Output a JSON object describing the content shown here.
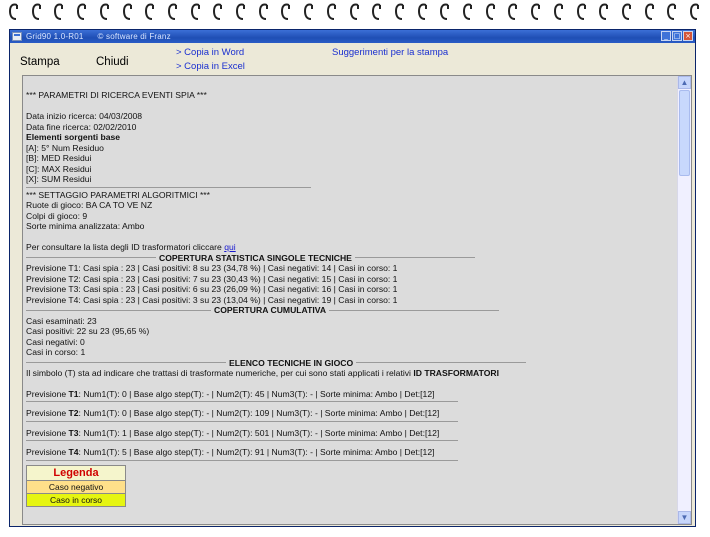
{
  "window": {
    "app_title": "Grid90 1.0-R01",
    "copyright": "© software di Franz",
    "buttons": {
      "minimize": "_",
      "maximize": "□",
      "close": "×"
    }
  },
  "toolbar": {
    "stampa": "Stampa",
    "chiudi": "Chiudi",
    "copia_word": "> Copia in Word",
    "copia_excel": "> Copia in Excel",
    "suggerimenti": "Suggerimenti per la stampa"
  },
  "report": {
    "header": "*** PARAMETRI DI RICERCA EVENTI SPIA ***",
    "data_inizio": "Data inizio ricerca: 04/03/2008",
    "data_fine": "Data fine ricerca: 02/02/2010",
    "elementi_title": "Elementi sorgenti base",
    "elementi": [
      "[A]: 5° Num Residuo",
      "[B]: MED Residui",
      "[C]: MAX Residui",
      "[X]: SUM Residui"
    ],
    "settaggio_title": "*** SETTAGGIO PARAMETRI ALGORITMICI ***",
    "ruote": "Ruote di gioco: BA CA TO VE NZ",
    "colpi": "Colpi di gioco: 9",
    "sorte": "Sorte minima analizzata: Ambo",
    "consult_text": "Per consultare la lista degli ID trasformatori cliccare ",
    "consult_link": "qui",
    "copertura_title": "COPERTURA STATISTICA SINGOLE TECNICHE",
    "previsioni_stat": [
      "Previsione T1: Casi spia : 23 | Casi positivi: 8 su 23 (34,78 %) | Casi negativi: 14 | Casi in corso: 1",
      "Previsione T2: Casi spia : 23 | Casi positivi: 7 su 23 (30,43 %) | Casi negativi: 15 | Casi in corso: 1",
      "Previsione T3: Casi spia : 23 | Casi positivi: 6 su 23 (26,09 %) | Casi negativi: 16 | Casi in corso: 1",
      "Previsione T4: Casi spia : 23 | Casi positivi: 3 su 23 (13,04 %) | Casi negativi: 19 | Casi in corso: 1"
    ],
    "cumulativa_title": "COPERTURA CUMULATIVA",
    "casi_esaminati": "Casi esaminati: 23",
    "casi_positivi": "Casi positivi: 22 su 23 (95,65 %)",
    "casi_negativi": "Casi negativi: 0",
    "casi_in_corso": "Casi in corso: 1",
    "elenco_title": "ELENCO TECNICHE IN GIOCO",
    "simbolo_text": "Il simbolo (T) sta ad indicare che trattasi di trasformate numeriche, per cui sono stati applicati i relativi ",
    "simbolo_bold": "ID TRASFORMATORI",
    "tecniche": [
      {
        "label": "Previsione ",
        "id": "T1",
        "rest": ": Num1(T): 0 | Base algo step(T): - | Num2(T): 45 | Num3(T): - | Sorte minima: Ambo | Det:[12]"
      },
      {
        "label": "Previsione ",
        "id": "T2",
        "rest": ": Num1(T): 0 | Base algo step(T): - | Num2(T): 109 | Num3(T): - | Sorte minima: Ambo | Det:[12]"
      },
      {
        "label": "Previsione ",
        "id": "T3",
        "rest": ": Num1(T): 1 | Base algo step(T): - | Num2(T): 501 | Num3(T): - | Sorte minima: Ambo | Det:[12]"
      },
      {
        "label": "Previsione ",
        "id": "T4",
        "rest": ": Num1(T): 5 | Base algo step(T): - | Num2(T): 91 | Num3(T): - | Sorte minima: Ambo | Det:[12]"
      }
    ]
  },
  "legend": {
    "title": "Legenda",
    "negativo": "Caso negativo",
    "in_corso": "Caso in corso"
  },
  "scrollbar": {
    "up": "▲",
    "down": "▼"
  },
  "colors": {
    "title_bar": "#1f4fb5",
    "link": "#1a2fd0",
    "content_bg": "#dcdcdc",
    "legend_negativo": "#ffe08a",
    "legend_in_corso": "#e6f511",
    "legend_title": "#d00000"
  }
}
